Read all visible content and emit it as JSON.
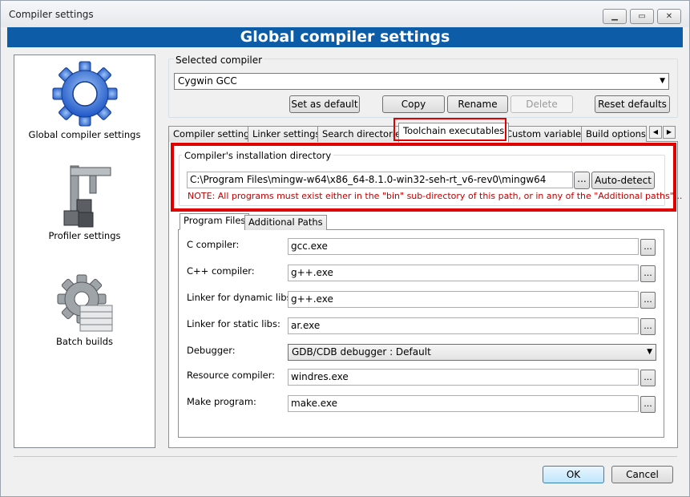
{
  "window": {
    "title": "Compiler settings",
    "minimize_icon": "minimize-icon",
    "maximize_icon": "maximize-icon",
    "close_icon": "close-icon"
  },
  "banner": {
    "title": "Global compiler settings"
  },
  "sidebar": {
    "items": [
      {
        "label": "Global compiler settings",
        "icon": "gear-icon"
      },
      {
        "label": "Profiler settings",
        "icon": "caliper-icon"
      },
      {
        "label": "Batch builds",
        "icon": "batch-gear-icon"
      }
    ]
  },
  "compiler": {
    "label": "Selected compiler",
    "selected": "Cygwin GCC",
    "buttons": {
      "set_default": "Set as default",
      "copy": "Copy",
      "rename": "Rename",
      "delete": "Delete",
      "reset": "Reset defaults"
    }
  },
  "tabs": [
    "Compiler settings",
    "Linker settings",
    "Search directories",
    "Toolchain executables",
    "Custom variables",
    "Build options"
  ],
  "active_tab": "Toolchain executables",
  "install_dir": {
    "legend": "Compiler's installation directory",
    "path": "C:\\Program Files\\mingw-w64\\x86_64-8.1.0-win32-seh-rt_v6-rev0\\mingw64",
    "browse": "...",
    "autodetect": "Auto-detect",
    "note": "NOTE: All programs must exist either in the \"bin\" sub-directory of this path, or in any of the \"Additional paths\"..."
  },
  "subtabs": [
    "Program Files",
    "Additional Paths"
  ],
  "programs": [
    {
      "label": "C compiler:",
      "value": "gcc.exe"
    },
    {
      "label": "C++ compiler:",
      "value": "g++.exe"
    },
    {
      "label": "Linker for dynamic libs:",
      "value": "g++.exe"
    },
    {
      "label": "Linker for static libs:",
      "value": "ar.exe"
    },
    {
      "label": "Debugger:",
      "value": "GDB/CDB debugger : Default"
    },
    {
      "label": "Resource compiler:",
      "value": "windres.exe"
    },
    {
      "label": "Make program:",
      "value": "make.exe"
    }
  ],
  "footer": {
    "ok": "OK",
    "cancel": "Cancel"
  },
  "colors": {
    "banner": "#0d5ca8",
    "highlight": "#e00000",
    "note": "#c00000"
  }
}
